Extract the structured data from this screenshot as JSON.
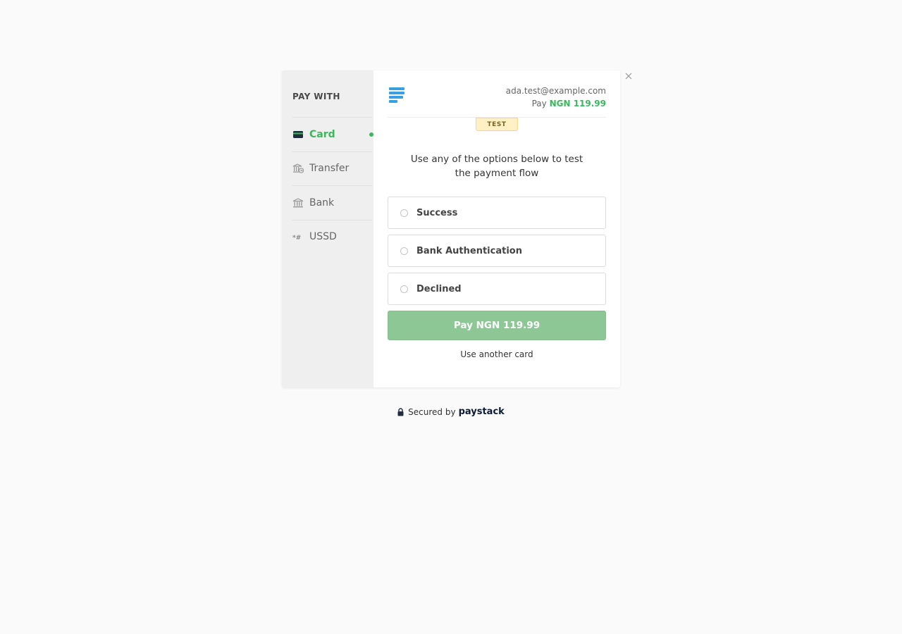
{
  "sidebar": {
    "title": "PAY WITH",
    "items": [
      {
        "label": "Card",
        "icon": "card-icon",
        "active": true
      },
      {
        "label": "Transfer",
        "icon": "bank-transfer-icon"
      },
      {
        "label": "Bank",
        "icon": "bank-icon"
      },
      {
        "label": "USSD",
        "icon": "ussd-icon"
      }
    ]
  },
  "header": {
    "email": "ada.test@example.com",
    "pay_prefix": "Pay",
    "amount": "NGN 119.99"
  },
  "badge": "TEST",
  "instructions": "Use any of the options below to test the payment flow",
  "options": [
    {
      "label": "Success"
    },
    {
      "label": "Bank Authentication"
    },
    {
      "label": "Declined"
    }
  ],
  "pay_button": "Pay NGN 119.99",
  "alt_link": "Use another card",
  "footer": {
    "secured_text": "Secured by",
    "brand": "paystack"
  },
  "colors": {
    "accent": "#3bb75e",
    "button": "#8dc795",
    "logo": "#3a9fe0"
  }
}
